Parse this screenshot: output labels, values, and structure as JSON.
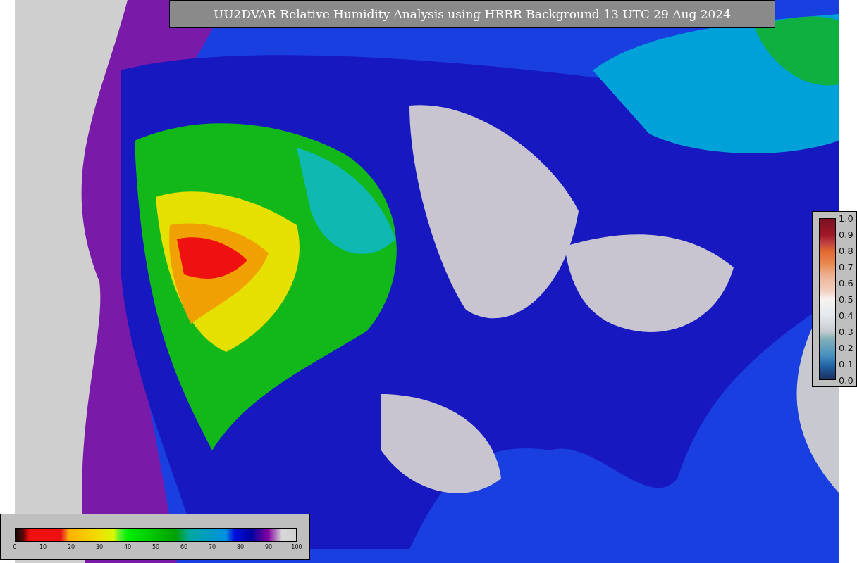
{
  "title": "UU2DVAR Relative Humidity Analysis using HRRR Background 13 UTC 29 Aug 2024",
  "humidity_colorbar": {
    "ticks": [
      "0",
      "10",
      "20",
      "30",
      "40",
      "50",
      "60",
      "70",
      "80",
      "90",
      "100"
    ]
  },
  "ratio_colorbar": {
    "ticks": [
      "1.0",
      "0.9",
      "0.8",
      "0.7",
      "0.6",
      "0.5",
      "0.4",
      "0.3",
      "0.2",
      "0.1",
      "0.0"
    ]
  }
}
